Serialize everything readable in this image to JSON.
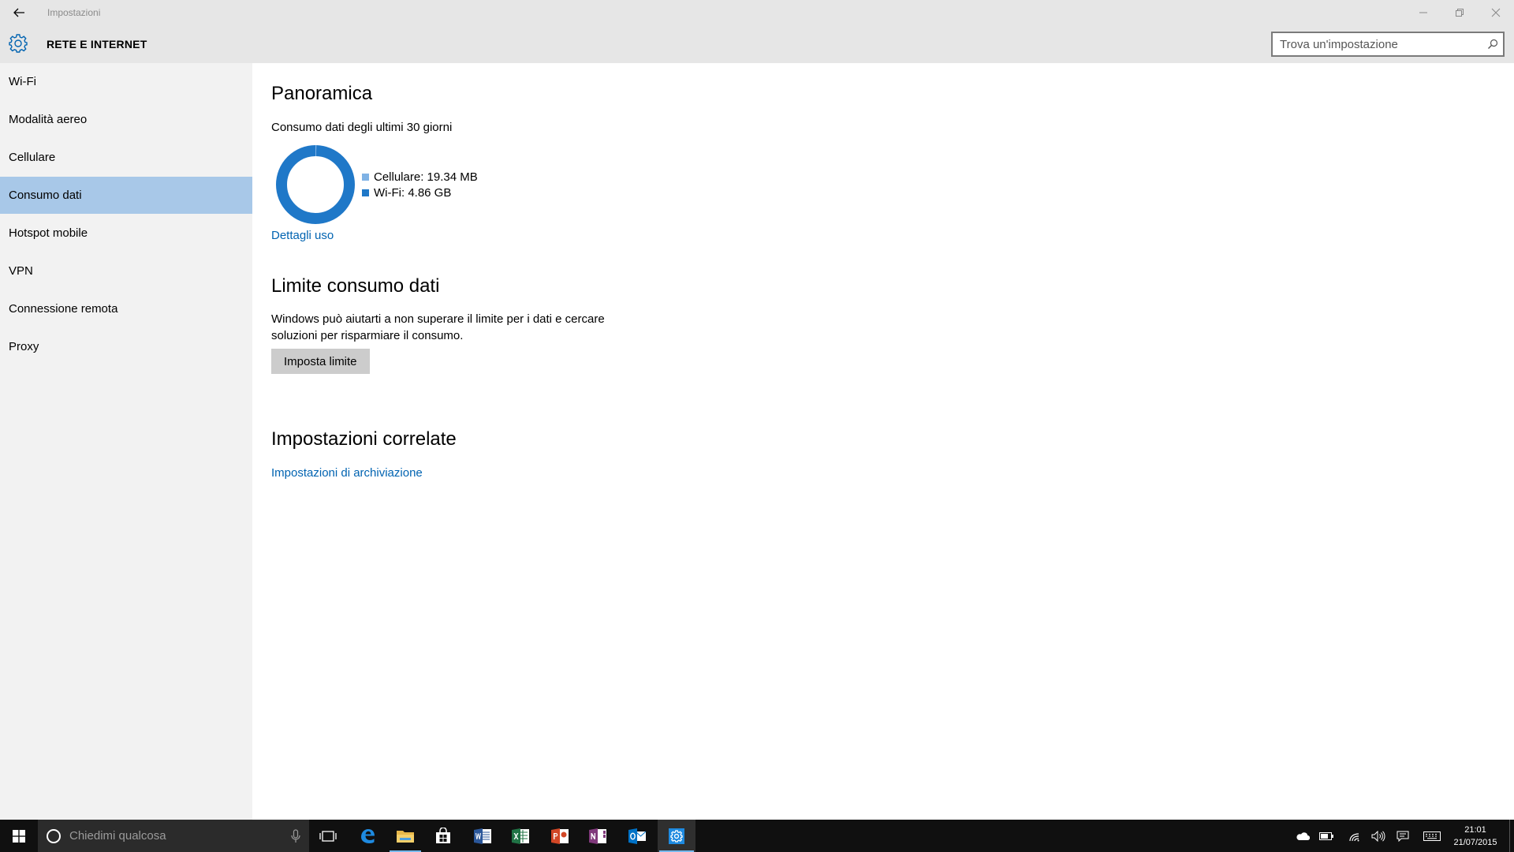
{
  "window": {
    "title": "Impostazioni",
    "section_title": "RETE E INTERNET"
  },
  "search": {
    "placeholder": "Trova un'impostazione"
  },
  "sidebar": {
    "items": [
      {
        "label": "Wi-Fi"
      },
      {
        "label": "Modalità aereo"
      },
      {
        "label": "Cellulare"
      },
      {
        "label": "Consumo dati",
        "selected": true
      },
      {
        "label": "Hotspot mobile"
      },
      {
        "label": "VPN"
      },
      {
        "label": "Connessione remota"
      },
      {
        "label": "Proxy"
      }
    ]
  },
  "overview": {
    "heading": "Panoramica",
    "subtitle": "Consumo dati degli ultimi 30 giorni",
    "details_link": "Dettagli uso"
  },
  "chart_data": {
    "type": "pie",
    "categories": [
      "Cellulare: 19.34 MB",
      "Wi-Fi: 4.86 GB"
    ],
    "values_mb": [
      19.34,
      4976.64
    ],
    "colors": [
      "#7fb2e5",
      "#1f78c8"
    ]
  },
  "limit": {
    "heading": "Limite consumo dati",
    "description_line1": "Windows può aiutarti a non superare il limite per i dati e cercare",
    "description_line2": "soluzioni per risparmiare il consumo.",
    "button_label": "Imposta limite"
  },
  "related": {
    "heading": "Impostazioni correlate",
    "storage_link": "Impostazioni di archiviazione"
  },
  "taskbar": {
    "search_placeholder": "Chiedimi qualcosa",
    "time": "21:01",
    "date": "21/07/2015",
    "apps": [
      "task-view",
      "edge",
      "file-explorer",
      "store",
      "word",
      "excel",
      "powerpoint",
      "onenote",
      "outlook",
      "settings"
    ]
  },
  "colors": {
    "accent": "#0063b1",
    "selection": "#a8c8e8",
    "chrome": "#e6e6e6",
    "sidebar": "#f2f2f2",
    "taskbar": "#101010"
  }
}
